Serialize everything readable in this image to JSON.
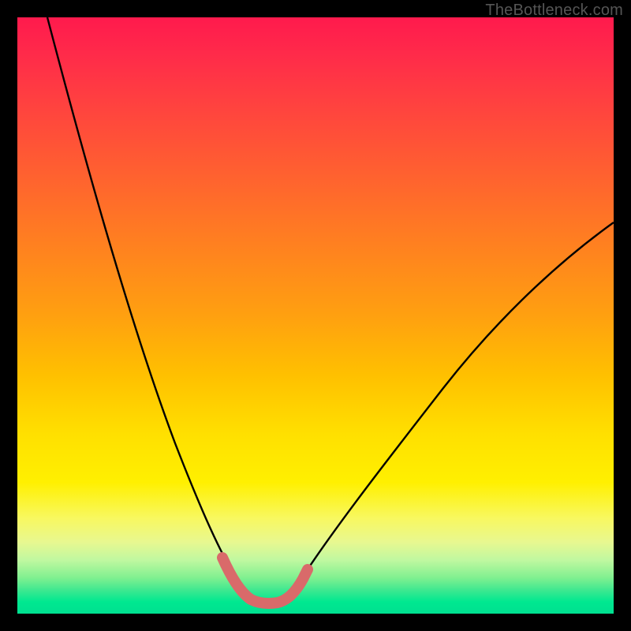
{
  "watermark": "TheBottleneck.com",
  "colors": {
    "background": "#000000",
    "curve_stroke": "#000000",
    "highlight_stroke": "#d96a6a",
    "gradient_stops": [
      "#ff1a4d",
      "#ff4040",
      "#ff8020",
      "#ffc000",
      "#fff000",
      "#c0f8a0",
      "#00e890"
    ]
  },
  "chart_data": {
    "type": "line",
    "title": "",
    "xlabel": "",
    "ylabel": "",
    "xlim": [
      0,
      100
    ],
    "ylim": [
      0,
      100
    ],
    "grid": false,
    "series": [
      {
        "name": "bottleneck-curve",
        "x": [
          5,
          10,
          15,
          20,
          25,
          30,
          32,
          34,
          36,
          38,
          40,
          42,
          44,
          46,
          50,
          55,
          60,
          65,
          70,
          75,
          80,
          85,
          90,
          95,
          100
        ],
        "y": [
          100,
          84,
          68,
          54,
          41,
          28,
          22,
          16,
          10,
          6,
          4,
          3,
          3,
          3,
          5,
          9,
          14,
          20,
          26,
          32,
          38,
          44,
          49,
          54,
          59
        ]
      },
      {
        "name": "highlight-trough",
        "x": [
          34,
          35,
          36,
          37,
          38,
          39,
          40,
          41,
          42,
          43,
          44,
          45,
          46,
          47,
          48
        ],
        "y": [
          16,
          13,
          10,
          8,
          6,
          5,
          4,
          3.5,
          3,
          3,
          3,
          3.2,
          3.5,
          4,
          4.8
        ]
      }
    ],
    "annotations": []
  }
}
